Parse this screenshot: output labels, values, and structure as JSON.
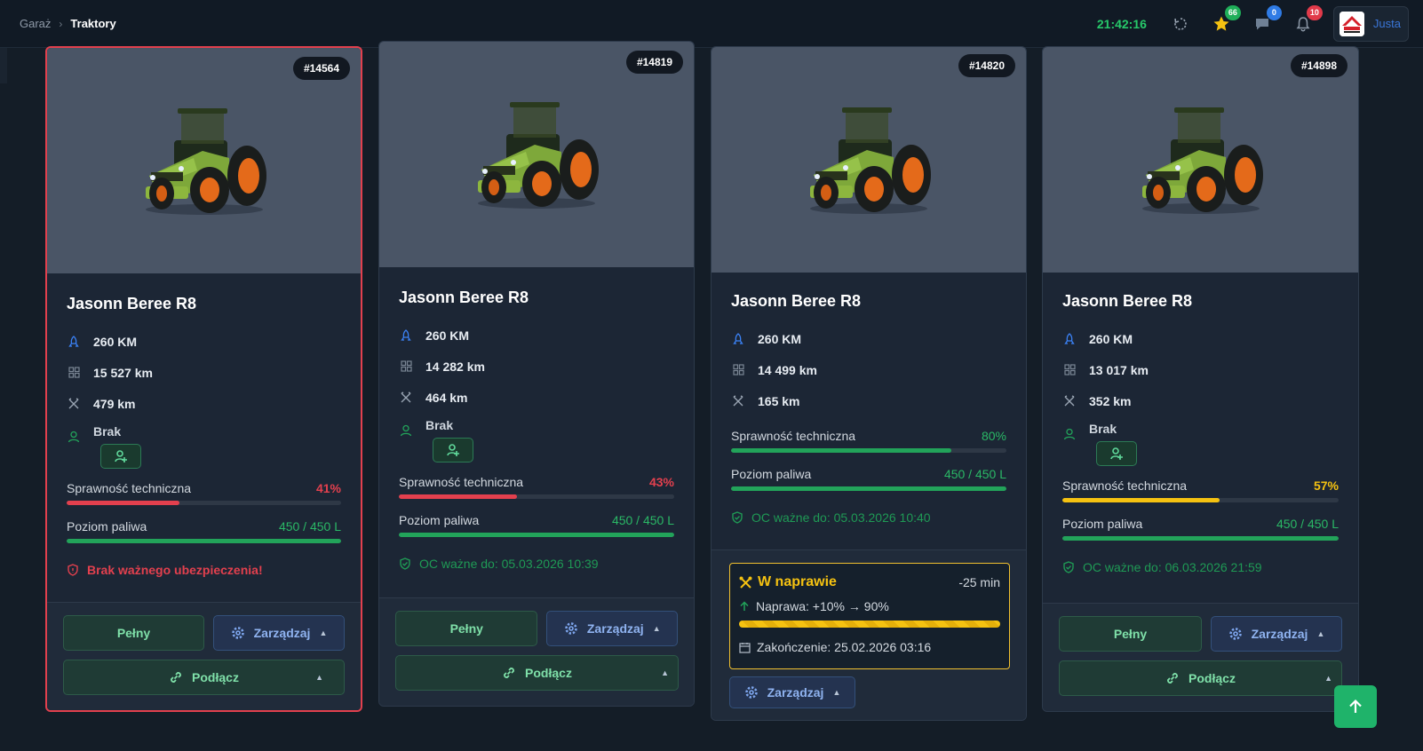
{
  "breadcrumb": {
    "home": "Garaż",
    "separator": "›",
    "current": "Traktory"
  },
  "topbar": {
    "clock": "21:42:16",
    "badges": {
      "favorites": "66",
      "messages": "0",
      "notifications": "10"
    },
    "user": {
      "name": "Justa"
    }
  },
  "colors": {
    "red": "#e3404e",
    "green": "#22a35a",
    "yellow": "#f5c211",
    "greenText": "#2ab866"
  },
  "cards": [
    {
      "id": "#14564",
      "name": "Jasonn Beree R8",
      "power": "260 KM",
      "mileage": "15 527 km",
      "service": "479 km",
      "owner": "Brak",
      "tech_label": "Sprawność techniczna",
      "tech_value": "41%",
      "tech_pct": 41,
      "fuel_label": "Poziom paliwa",
      "fuel_value": "450 / 450 L",
      "fuel_pct": 100,
      "insurance": "Brak ważnego ubezpieczenia!",
      "btn_full": "Pełny",
      "btn_manage": "Zarządzaj",
      "btn_connect": "Podłącz"
    },
    {
      "id": "#14819",
      "name": "Jasonn Beree R8",
      "power": "260 KM",
      "mileage": "14 282 km",
      "service": "464 km",
      "owner": "Brak",
      "tech_label": "Sprawność techniczna",
      "tech_value": "43%",
      "tech_pct": 43,
      "fuel_label": "Poziom paliwa",
      "fuel_value": "450 / 450 L",
      "fuel_pct": 100,
      "insurance": "OC ważne do: 05.03.2026 10:39",
      "btn_full": "Pełny",
      "btn_manage": "Zarządzaj",
      "btn_connect": "Podłącz"
    },
    {
      "id": "#14820",
      "name": "Jasonn Beree R8",
      "power": "260 KM",
      "mileage": "14 499 km",
      "service": "165 km",
      "tech_label": "Sprawność techniczna",
      "tech_value": "80%",
      "tech_pct": 80,
      "fuel_label": "Poziom paliwa",
      "fuel_value": "450 / 450 L",
      "fuel_pct": 100,
      "insurance": "OC ważne do: 05.03.2026 10:40",
      "repair": {
        "title": "W naprawie",
        "remaining": "-25 min",
        "progress_label": "Naprawa: +10% → 90%",
        "progress_pct": 100,
        "end": "Zakończenie: 25.02.2026 03:16"
      },
      "btn_manage": "Zarządzaj"
    },
    {
      "id": "#14898",
      "name": "Jasonn Beree R8",
      "power": "260 KM",
      "mileage": "13 017 km",
      "service": "352 km",
      "owner": "Brak",
      "tech_label": "Sprawność techniczna",
      "tech_value": "57%",
      "tech_pct": 57,
      "fuel_label": "Poziom paliwa",
      "fuel_value": "450 / 450 L",
      "fuel_pct": 100,
      "insurance": "OC ważne do: 06.03.2026 21:59",
      "btn_full": "Pełny",
      "btn_manage": "Zarządzaj",
      "btn_connect": "Podłącz"
    }
  ]
}
